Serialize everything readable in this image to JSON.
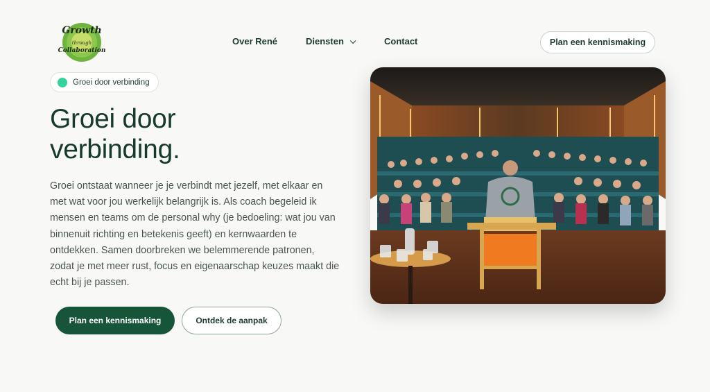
{
  "header": {
    "logo": {
      "line1": "Growth",
      "line2": "through",
      "line3": "Collaboration"
    },
    "nav": [
      {
        "label": "Over René",
        "dropdown": false
      },
      {
        "label": "Diensten",
        "dropdown": true
      },
      {
        "label": "Contact",
        "dropdown": false
      }
    ],
    "cta_label": "Plan een kennismaking"
  },
  "hero": {
    "badge_label": "Groei door verbinding",
    "title_line1": "Groei door",
    "title_line2": "verbinding.",
    "paragraph": "Groei ontstaat wanneer je je verbindt met jezelf, met elkaar en met wat voor jou werkelijk belangrijk is. Als coach begeleid ik mensen en teams om de personal why (je bedoeling: wat jou van binnenuit richting en betekenis geeft) en kernwaarden te ontdekken. Samen doorbreken we belemmerende patronen, zodat je met meer rust, focus en eigenaarschap keuzes maakt die echt bij je passen.",
    "primary_button": "Plan een kennismaking",
    "secondary_button": "Ontdek de aanpak"
  },
  "colors": {
    "brand_green": "#17553b",
    "badge_dot": "#34d399",
    "background": "#f8f8f6"
  }
}
